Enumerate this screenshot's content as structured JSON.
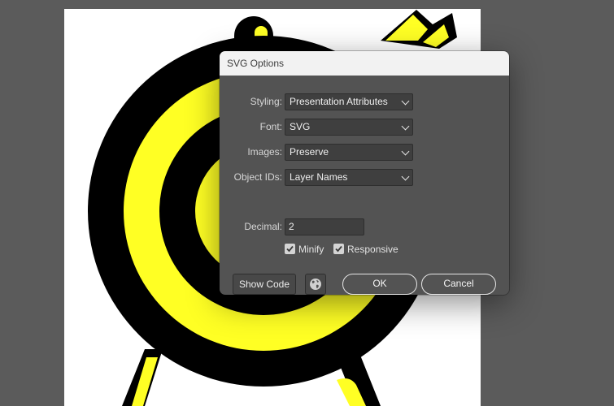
{
  "dialog": {
    "title": "SVG Options",
    "fields": {
      "styling": {
        "label": "Styling:",
        "value": "Presentation Attributes"
      },
      "font": {
        "label": "Font:",
        "value": "SVG"
      },
      "images": {
        "label": "Images:",
        "value": "Preserve"
      },
      "object_ids": {
        "label": "Object IDs:",
        "value": "Layer Names"
      },
      "decimal": {
        "label": "Decimal:",
        "value": "2"
      }
    },
    "options": {
      "minify": {
        "label": "Minify",
        "checked": true
      },
      "responsive": {
        "label": "Responsive",
        "checked": true
      }
    },
    "buttons": {
      "show_code": "Show Code",
      "ok": "OK",
      "cancel": "Cancel"
    }
  },
  "icons": {
    "chevron": "chevron-down-icon",
    "checkmark": "checkmark-icon",
    "web": "globe-icon"
  },
  "colors": {
    "workspace": "#5b5b5b",
    "artboard": "#ffffff",
    "artwork_yellow": "#ffff24",
    "artwork_black": "#000000",
    "dialog_bg": "#535353",
    "titlebar_bg": "#f2f2f2"
  }
}
